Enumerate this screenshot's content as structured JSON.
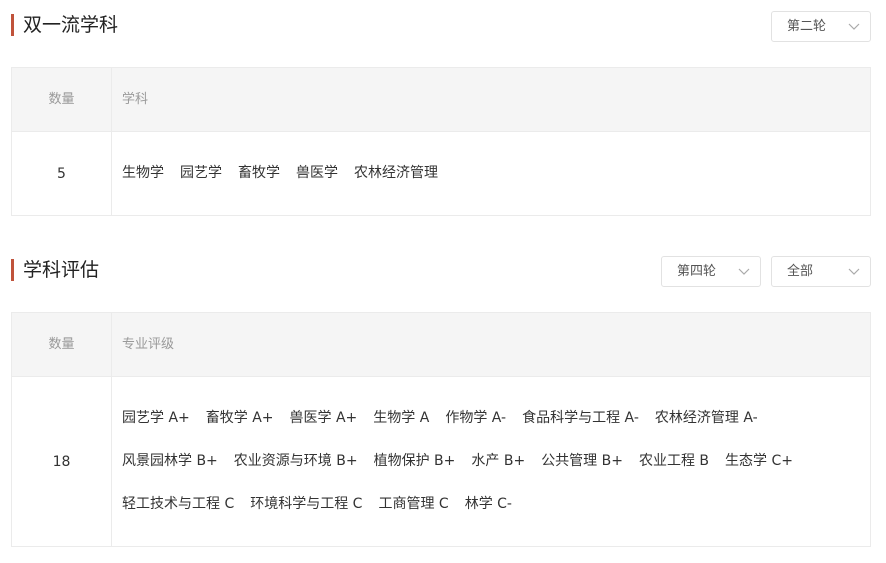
{
  "section1": {
    "title": "双一流学科",
    "round_select": "第二轮",
    "header": {
      "count": "数量",
      "subjects": "学科"
    },
    "count": "5",
    "subjects": [
      "生物学",
      "园艺学",
      "畜牧学",
      "兽医学",
      "农林经济管理"
    ]
  },
  "section2": {
    "title": "学科评估",
    "round_select": "第四轮",
    "scope_select": "全部",
    "header": {
      "count": "数量",
      "ratings": "专业评级"
    },
    "count": "18",
    "rows": [
      [
        "园艺学 A+",
        "畜牧学 A+",
        "兽医学 A+",
        "生物学 A",
        "作物学 A-",
        "食品科学与工程 A-",
        "农林经济管理 A-"
      ],
      [
        "风景园林学 B+",
        "农业资源与环境 B+",
        "植物保护 B+",
        "水产 B+",
        "公共管理 B+",
        "农业工程 B",
        "生态学 C+"
      ],
      [
        "轻工技术与工程 C",
        "环境科学与工程 C",
        "工商管理 C",
        "林学 C-"
      ]
    ]
  },
  "colors": {
    "accent": "#c0533b",
    "header_bg": "#f5f5f5",
    "border": "#ebebeb"
  }
}
